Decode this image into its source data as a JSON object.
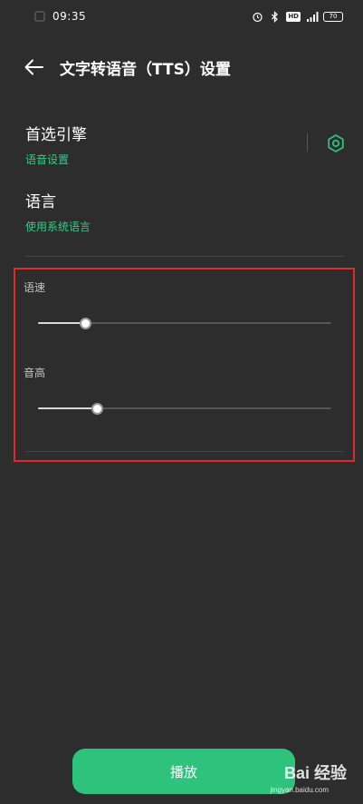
{
  "status_bar": {
    "time": "09:35",
    "hd_badge": "HD",
    "signal_label": "4G",
    "battery": "70"
  },
  "header": {
    "title": "文字转语音（TTS）设置"
  },
  "preferred_engine": {
    "title": "首选引擎",
    "subtitle": "语音设置"
  },
  "language": {
    "title": "语言",
    "subtitle": "使用系统语言"
  },
  "sliders": {
    "speech_rate": {
      "label": "语速",
      "value": 0.16
    },
    "pitch": {
      "label": "音高",
      "value": 0.2
    }
  },
  "play_button": {
    "label": "播放"
  },
  "watermark": {
    "text": "Bai 经验",
    "sub": "jingyan.baidu.com"
  },
  "colors": {
    "accent": "#2ec37d",
    "link_green": "#37c98a",
    "background": "#2d2d2d",
    "highlight": "#e02a2a"
  }
}
